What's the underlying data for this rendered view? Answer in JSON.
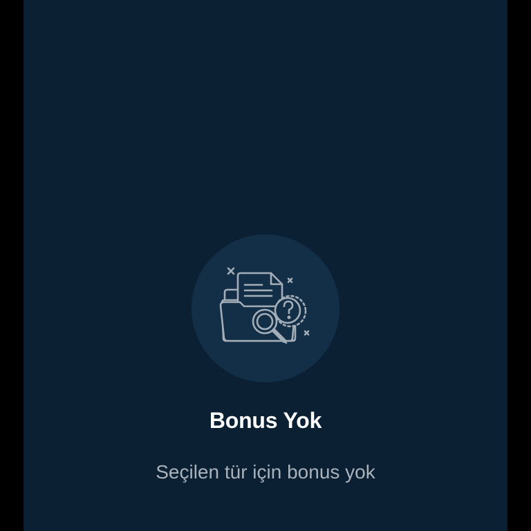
{
  "empty_state": {
    "icon": "folder-document-search-question-icon",
    "title": "Bonus Yok",
    "subtitle": "Seçilen tür için bonus yok"
  },
  "colors": {
    "background": "#0b2033",
    "side_bars": "#000000",
    "illustration_circle": "#132f47",
    "illustration_stroke": "#a3aeb8",
    "title": "#ffffff",
    "subtitle": "#aab2bc"
  }
}
